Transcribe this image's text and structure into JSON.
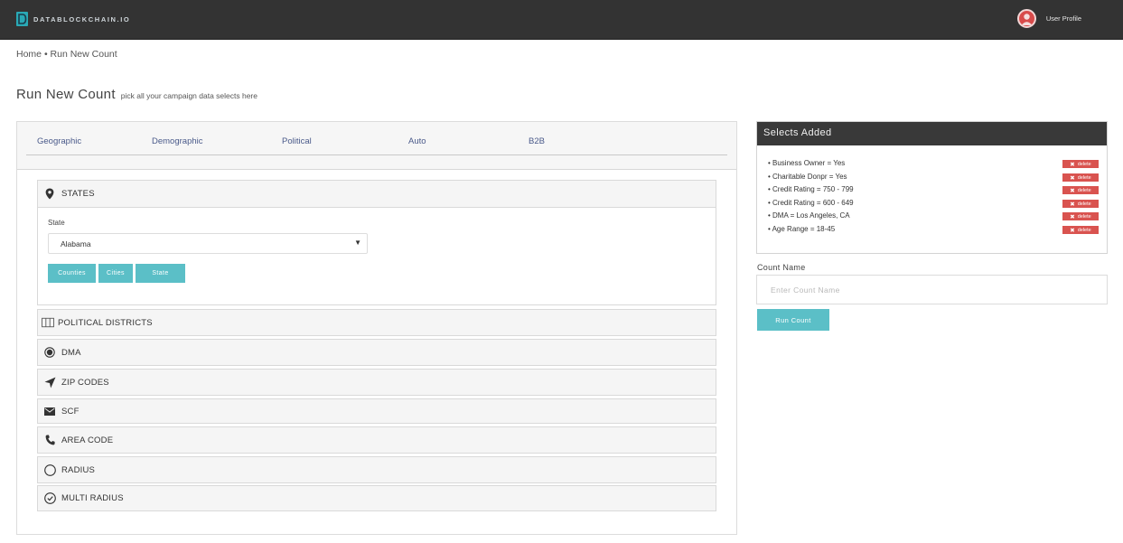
{
  "header": {
    "logo_text": "DATABLOCKCHAIN.IO",
    "profile_label": "User Profile"
  },
  "breadcrumb": {
    "home": "Home",
    "separator": "•",
    "current": "Run New Count"
  },
  "page": {
    "title": "Run New Count",
    "subtitle": "pick all your campaign data selects here"
  },
  "tabs": [
    {
      "label": "Geographic"
    },
    {
      "label": "Demographic"
    },
    {
      "label": "Political"
    },
    {
      "label": "Auto"
    },
    {
      "label": "B2B"
    }
  ],
  "sections": {
    "states": {
      "label": "STATES",
      "icon": "map-pin-icon",
      "field_label": "State",
      "selected_state": "Alabama",
      "buttons": [
        "Counties",
        "Cities",
        "State"
      ]
    },
    "political_districts": {
      "label": "POLITICAL DISTRICTS",
      "icon": "map-icon"
    },
    "dma": {
      "label": "DMA",
      "icon": "radio-dot-icon"
    },
    "zip_codes": {
      "label": "ZIP CODES",
      "icon": "navigation-arrow-icon"
    },
    "scf": {
      "label": "SCF",
      "icon": "envelope-icon"
    },
    "area_code": {
      "label": "AREA CODE",
      "icon": "phone-icon"
    },
    "radius": {
      "label": "RADIUS",
      "icon": "circle-icon"
    },
    "multi_radius": {
      "label": "MULTI RADIUS",
      "icon": "check-circle-icon"
    }
  },
  "selects_panel": {
    "title": "Selects Added",
    "delete_label": "delete",
    "items": [
      {
        "text": "• Business Owner = Yes"
      },
      {
        "text": "• Charitable Donpr = Yes"
      },
      {
        "text": "• Credit Rating = 750 - 799"
      },
      {
        "text": "• Credit Rating = 600 - 649"
      },
      {
        "text": "• DMA = Los Angeles, CA"
      },
      {
        "text": "• Age Range = 18-45"
      }
    ]
  },
  "count_form": {
    "label": "Count Name",
    "placeholder": "Enter Count Name",
    "value": "",
    "run_button": "Run Count"
  },
  "colors": {
    "topbar": "#333333",
    "accent_teal": "#5bbfc7",
    "delete_red": "#d9534f",
    "tab_text": "#4a5a8a"
  }
}
